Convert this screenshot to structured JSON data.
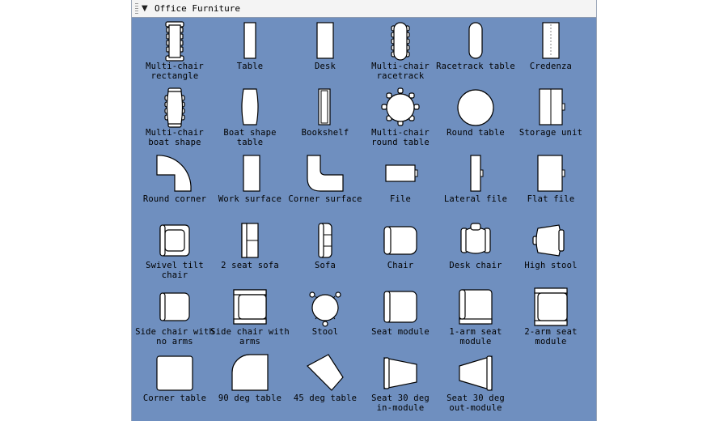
{
  "panel": {
    "title": "Office Furniture",
    "collapse_icon": "triangle-down-icon",
    "items": [
      {
        "label": "Multi-chair\nrectangle",
        "icon": "multi-chair-rectangle-icon"
      },
      {
        "label": "Table",
        "icon": "table-icon"
      },
      {
        "label": "Desk",
        "icon": "desk-icon"
      },
      {
        "label": "Multi-chair\nracetrack",
        "icon": "multi-chair-racetrack-icon"
      },
      {
        "label": "Racetrack table",
        "icon": "racetrack-table-icon"
      },
      {
        "label": "Credenza",
        "icon": "credenza-icon"
      },
      {
        "label": "Multi-chair\nboat shape",
        "icon": "multi-chair-boat-icon"
      },
      {
        "label": "Boat shape\ntable",
        "icon": "boat-shape-table-icon"
      },
      {
        "label": "Bookshelf",
        "icon": "bookshelf-icon"
      },
      {
        "label": "Multi-chair\nround table",
        "icon": "multi-chair-round-table-icon"
      },
      {
        "label": "Round table",
        "icon": "round-table-icon"
      },
      {
        "label": "Storage unit",
        "icon": "storage-unit-icon"
      },
      {
        "label": "Round corner",
        "icon": "round-corner-icon"
      },
      {
        "label": "Work surface",
        "icon": "work-surface-icon"
      },
      {
        "label": "Corner surface",
        "icon": "corner-surface-icon"
      },
      {
        "label": "File",
        "icon": "file-icon"
      },
      {
        "label": "Lateral file",
        "icon": "lateral-file-icon"
      },
      {
        "label": "Flat file",
        "icon": "flat-file-icon"
      },
      {
        "label": "Swivel tilt\nchair",
        "icon": "swivel-tilt-chair-icon"
      },
      {
        "label": "2 seat sofa",
        "icon": "two-seat-sofa-icon"
      },
      {
        "label": "Sofa",
        "icon": "sofa-icon"
      },
      {
        "label": "Chair",
        "icon": "chair-icon"
      },
      {
        "label": "Desk chair",
        "icon": "desk-chair-icon"
      },
      {
        "label": "High stool",
        "icon": "high-stool-icon"
      },
      {
        "label": "Side chair with\nno arms",
        "icon": "side-chair-no-arms-icon"
      },
      {
        "label": "Side chair with\narms",
        "icon": "side-chair-arms-icon"
      },
      {
        "label": "Stool",
        "icon": "stool-icon"
      },
      {
        "label": "Seat module",
        "icon": "seat-module-icon"
      },
      {
        "label": "1-arm seat\nmodule",
        "icon": "one-arm-seat-module-icon"
      },
      {
        "label": "2-arm seat\nmodule",
        "icon": "two-arm-seat-module-icon"
      },
      {
        "label": "Corner table",
        "icon": "corner-table-icon"
      },
      {
        "label": "90 deg table",
        "icon": "ninety-deg-table-icon"
      },
      {
        "label": "45 deg table",
        "icon": "forty-five-deg-table-icon"
      },
      {
        "label": "Seat 30 deg\nin-module",
        "icon": "seat-30-in-module-icon"
      },
      {
        "label": "Seat 30 deg\nout-module",
        "icon": "seat-30-out-module-icon"
      }
    ]
  }
}
